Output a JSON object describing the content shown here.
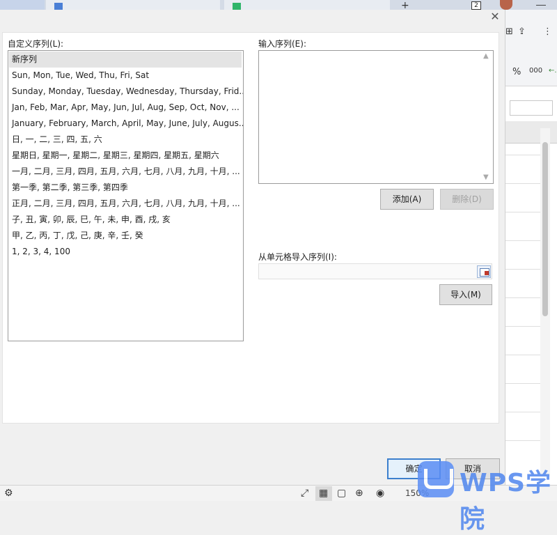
{
  "background": {
    "tabs": [
      "",
      "",
      ""
    ],
    "tab_count_badge": "2",
    "zoom_level": "150%"
  },
  "dialog": {
    "custom_lists_label": "自定义序列(L):",
    "input_list_label": "输入序列(E):",
    "import_label": "从单元格导入序列(I):",
    "add_button": "添加(A)",
    "delete_button": "删除(D)",
    "import_button": "导入(M)",
    "ok_button": "确定",
    "cancel_button": "取消",
    "lists": [
      "新序列",
      "Sun, Mon, Tue, Wed, Thu, Fri, Sat",
      "Sunday, Monday, Tuesday, Wednesday, Thursday, Frid...",
      "Jan, Feb, Mar, Apr, May, Jun, Jul, Aug, Sep, Oct, Nov, ...",
      "January, February, March, April, May, June, July, Augus...",
      "日, 一, 二, 三, 四, 五, 六",
      "星期日, 星期一, 星期二, 星期三, 星期四, 星期五, 星期六",
      "一月, 二月, 三月, 四月, 五月, 六月, 七月, 八月, 九月, 十月, ...",
      "第一季, 第二季, 第三季, 第四季",
      "正月, 二月, 三月, 四月, 五月, 六月, 七月, 八月, 九月, 十月, ...",
      "子, 丑, 寅, 卯, 辰, 巳, 午, 未, 申, 酉, 戌, 亥",
      "甲, 乙, 丙, 丁, 戊, 己, 庚, 辛, 壬, 癸",
      "1, 2, 3, 4, 100"
    ],
    "selected_index": 0,
    "input_list_value": "",
    "import_range_value": ""
  },
  "watermark": {
    "text": "WPS学院"
  }
}
